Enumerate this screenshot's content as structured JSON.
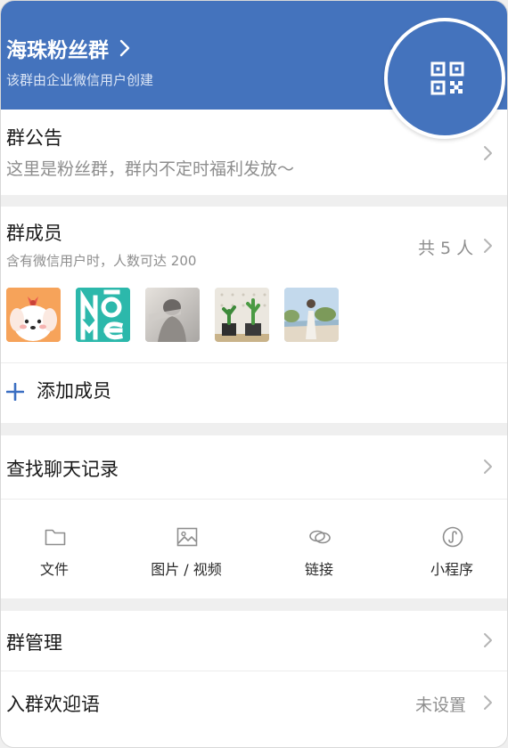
{
  "header": {
    "title": "海珠粉丝群",
    "subtitle": "该群由企业微信用户创建",
    "qr_icon": "qr-code-icon"
  },
  "notice": {
    "title": "群公告",
    "content": "这里是粉丝群，群内不定时福利发放～"
  },
  "members": {
    "title": "群成员",
    "subtitle": "含有微信用户时，人数可达 200",
    "count_label": "共 5 人",
    "avatars": [
      "avatar-cartoon-dog",
      "avatar-nome-logo",
      "avatar-person-photo",
      "avatar-plants-photo",
      "avatar-beach-photo"
    ],
    "add_label": "添加成员"
  },
  "search": {
    "title": "查找聊天记录",
    "tools": [
      {
        "label": "文件",
        "icon": "folder-icon"
      },
      {
        "label": "图片 / 视频",
        "icon": "image-icon"
      },
      {
        "label": "链接",
        "icon": "link-icon"
      },
      {
        "label": "小程序",
        "icon": "mini-program-icon"
      }
    ]
  },
  "manage": {
    "title": "群管理",
    "welcome_title": "入群欢迎语",
    "welcome_value": "未设置"
  },
  "colors": {
    "header_blue": "#4473bd",
    "accent_blue": "#3b6fc2",
    "text_gray": "#8e8e8e"
  }
}
